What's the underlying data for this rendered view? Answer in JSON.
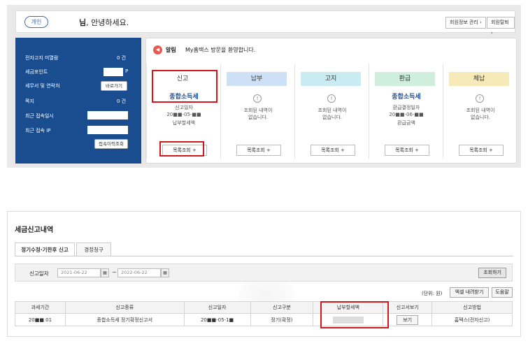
{
  "top": {
    "pill_label": "개인",
    "greeting_name": "님",
    "greeting_text": ", 안녕하세요.",
    "btn_member_info": "회원정보 관리 ›",
    "btn_withdraw": "회원탈퇴 ›"
  },
  "left": {
    "rows": [
      {
        "label": "전자고지 미열람",
        "value": "0 건"
      },
      {
        "label": "세금포인트",
        "value": "P"
      },
      {
        "label": "세무서 및 연락처",
        "value": "바로가기"
      },
      {
        "label": "쪽지",
        "value": "0 건"
      },
      {
        "label": "최근 접속일시",
        "value": ""
      },
      {
        "label": "최근 접속 IP",
        "value": ""
      }
    ],
    "history_btn": "접속이력조회"
  },
  "alert": {
    "icon": "speaker-icon",
    "label": "알림",
    "message": "My홈택스 방문을 환영합니다."
  },
  "columns": [
    {
      "head": "신고",
      "color": "#ffffff",
      "title": "종합소득세",
      "lines": [
        "신고일자",
        "20■■-05-■■",
        "납부할세액"
      ],
      "btn": "목록조회 +",
      "has_icon": false
    },
    {
      "head": "납부",
      "color": "#cde0f5",
      "title": "",
      "lines": [
        "조회된 내역이",
        "없습니다."
      ],
      "btn": "목록조회 +",
      "has_icon": true
    },
    {
      "head": "고지",
      "color": "#c9ecf2",
      "title": "",
      "lines": [
        "조회된 내역이",
        "없습니다."
      ],
      "btn": "목록조회 +",
      "has_icon": true
    },
    {
      "head": "환급",
      "color": "#cfeedd",
      "title": "종합소득세",
      "lines": [
        "환급결정일자",
        "20■■-06-■■",
        "환급금액"
      ],
      "btn": "목록조회 +",
      "has_icon": false
    },
    {
      "head": "체납",
      "color": "#f6eab8",
      "title": "",
      "lines": [
        "조회된 내역이",
        "없습니다."
      ],
      "btn": "목록조회 +",
      "has_icon": true
    }
  ],
  "bottom": {
    "title": "세금신고내역",
    "tabs": [
      "정기수정·기한후 신고",
      "경정청구"
    ],
    "search_label": "신고일자",
    "date_from": "2021-06-22",
    "date_to": "2022-06-22",
    "tilde": "~",
    "query_btn": "조회하기",
    "unit": "(단위: 원)",
    "excel_btn": "엑셀 내려받기",
    "help_btn": "도움말",
    "headers": [
      "과세기간",
      "신고종류",
      "신고일자",
      "신고구분",
      "납부할세액",
      "신고서보기",
      "신고방법"
    ],
    "row": [
      "20■■ 01",
      "종합소득세 정기확정신고서",
      "20■■-05-1■",
      "정기(확정)",
      "",
      "보기",
      "홈택스(전자신고)"
    ]
  }
}
